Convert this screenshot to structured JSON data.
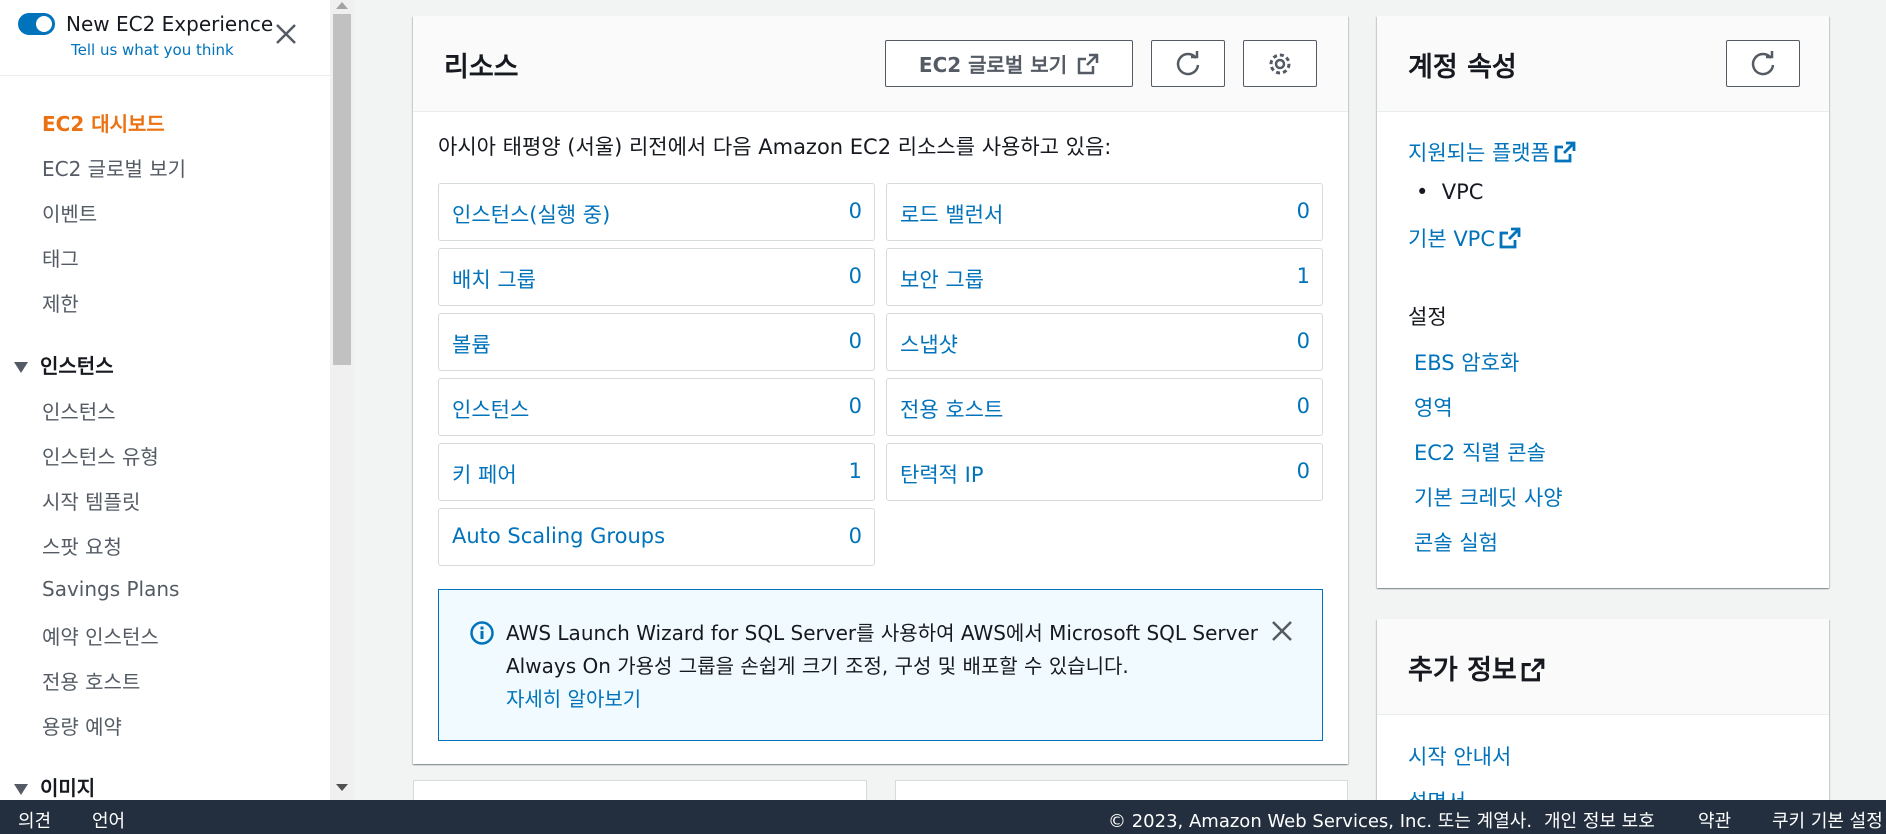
{
  "new_experience": {
    "title": "New EC2 Experience",
    "feedback_link": "Tell us what you think"
  },
  "sidebar": {
    "items": [
      {
        "label": "EC2 대시보드",
        "active": true
      },
      {
        "label": "EC2 글로벌 보기"
      },
      {
        "label": "이벤트"
      },
      {
        "label": "태그"
      },
      {
        "label": "제한"
      }
    ],
    "instances_section": {
      "title": "인스턴스",
      "items": [
        "인스턴스",
        "인스턴스 유형",
        "시작 템플릿",
        "스팟 요청",
        "Savings Plans",
        "예약 인스턴스",
        "전용 호스트",
        "용량 예약"
      ]
    },
    "images_section": {
      "title": "이미지"
    }
  },
  "resources": {
    "title": "리소스",
    "global_view_button": "EC2 글로벌 보기",
    "intro": "아시아 태평양 (서울) 리전에서 다음 Amazon EC2 리소스를 사용하고 있음:",
    "left": [
      {
        "name": "인스턴스(실행 중)",
        "count": "0"
      },
      {
        "name": "배치 그룹",
        "count": "0"
      },
      {
        "name": "볼륨",
        "count": "0"
      },
      {
        "name": "인스턴스",
        "count": "0"
      },
      {
        "name": "키 페어",
        "count": "1"
      },
      {
        "name": "Auto Scaling Groups",
        "count": "0"
      }
    ],
    "right": [
      {
        "name": "로드 밸런서",
        "count": "0"
      },
      {
        "name": "보안 그룹",
        "count": "1"
      },
      {
        "name": "스냅샷",
        "count": "0"
      },
      {
        "name": "전용 호스트",
        "count": "0"
      },
      {
        "name": "탄력적 IP",
        "count": "0"
      }
    ],
    "info": {
      "text": "AWS Launch Wizard for SQL Server를 사용하여 AWS에서 Microsoft SQL Server Always On 가용성 그룹을 손쉽게 크기 조정, 구성 및 배포할 수 있습니다.",
      "link": "자세히 알아보기"
    }
  },
  "account": {
    "title": "계정 속성",
    "supported_platforms": "지원되는 플랫폼",
    "platform_value": "VPC",
    "default_vpc": "기본 VPC",
    "settings_label": "설정",
    "settings": [
      "EBS 암호화",
      "영역",
      "EC2 직렬 콘솔",
      "기본 크레딧 사양",
      "콘솔 실험"
    ]
  },
  "more_info": {
    "title": "추가 정보",
    "items": [
      "시작 안내서",
      "설명서"
    ]
  },
  "footer": {
    "feedback": "의견",
    "language": "언어",
    "copyright": "© 2023, Amazon Web Services, Inc. 또는 계열사.",
    "privacy": "개인 정보 보호",
    "terms": "약관",
    "cookies": "쿠키 기본 설정"
  },
  "colors": {
    "link": "#0073bb",
    "active_nav": "#ec7211",
    "footer_bg": "#232f3e",
    "info_bg": "#f1faff"
  }
}
